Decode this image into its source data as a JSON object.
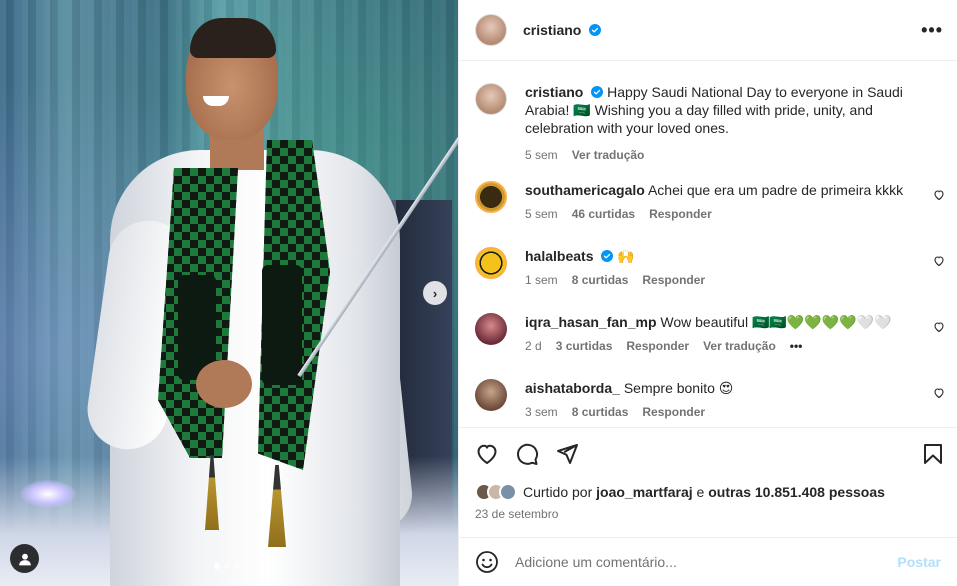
{
  "header": {
    "username": "cristiano",
    "more_label": "•••"
  },
  "caption": {
    "username": "cristiano",
    "text": "Happy Saudi National Day to everyone in Saudi Arabia! 🇸🇦 Wishing you a day filled with pride, unity, and celebration with your loved ones.",
    "time": "5 sem",
    "translate": "Ver tradução"
  },
  "comments": [
    {
      "username": "southamericagalo",
      "verified": false,
      "text": "Achei que era um padre de primeira kkkk",
      "time": "5 sem",
      "likes": "46 curtidas",
      "reply": "Responder"
    },
    {
      "username": "halalbeats",
      "verified": true,
      "text": "🙌",
      "time": "1 sem",
      "likes": "8 curtidas",
      "reply": "Responder"
    },
    {
      "username": "iqra_hasan_fan_mp",
      "verified": false,
      "text": "Wow beautiful 🇸🇦🇸🇦💚💚💚💚🤍🤍",
      "time": "2 d",
      "likes": "3 curtidas",
      "reply": "Responder",
      "translate": "Ver tradução",
      "more": "•••"
    },
    {
      "username": "aishataborda_",
      "verified": false,
      "text": "Sempre bonito 😍",
      "time": "3 sem",
      "likes": "8 curtidas",
      "reply": "Responder"
    }
  ],
  "likes": {
    "prefix": "Curtido por",
    "user": "joao_martfaraj",
    "middle": "e",
    "others": "outras 10.851.408 pessoas"
  },
  "date": "23 de setembro",
  "add_comment": {
    "placeholder": "Adicione um comentário...",
    "post_label": "Postar"
  },
  "carousel": {
    "total": 3,
    "active": 0,
    "next_label": "›"
  },
  "colors": {
    "verified": "#0095f6",
    "link": "#0095f6",
    "post_disabled": "#b2dffc",
    "secondary": "#737373"
  }
}
